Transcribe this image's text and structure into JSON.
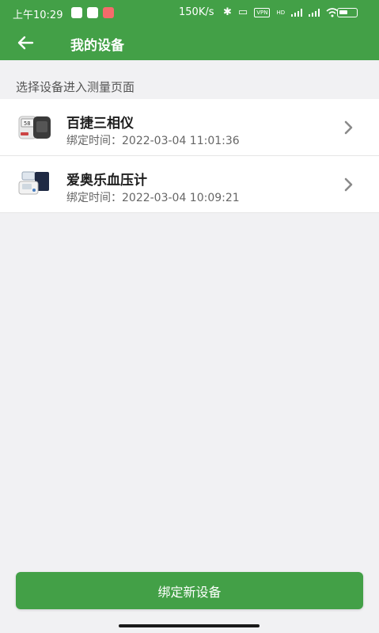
{
  "status_bar": {
    "time": "上午10:29",
    "net_speed": "150K/s",
    "vpn_label": "VPN",
    "hd_label": "HD",
    "battery_level": 0.5
  },
  "app_bar": {
    "back_icon": "arrow-left-icon",
    "title": "我的设备"
  },
  "section_hint": "选择设备进入测量页面",
  "devices": [
    {
      "name": "百捷三相仪",
      "time_label": "绑定时间：2022-03-04 11:01:36",
      "thumb_icon": "glucose-meter-icon"
    },
    {
      "name": "爱奥乐血压计",
      "time_label": "绑定时间：2022-03-04 10:09:21",
      "thumb_icon": "blood-pressure-monitor-icon"
    }
  ],
  "bind_button_label": "绑定新设备",
  "colors": {
    "primary": "#43a047",
    "background": "#f1f1f3"
  }
}
